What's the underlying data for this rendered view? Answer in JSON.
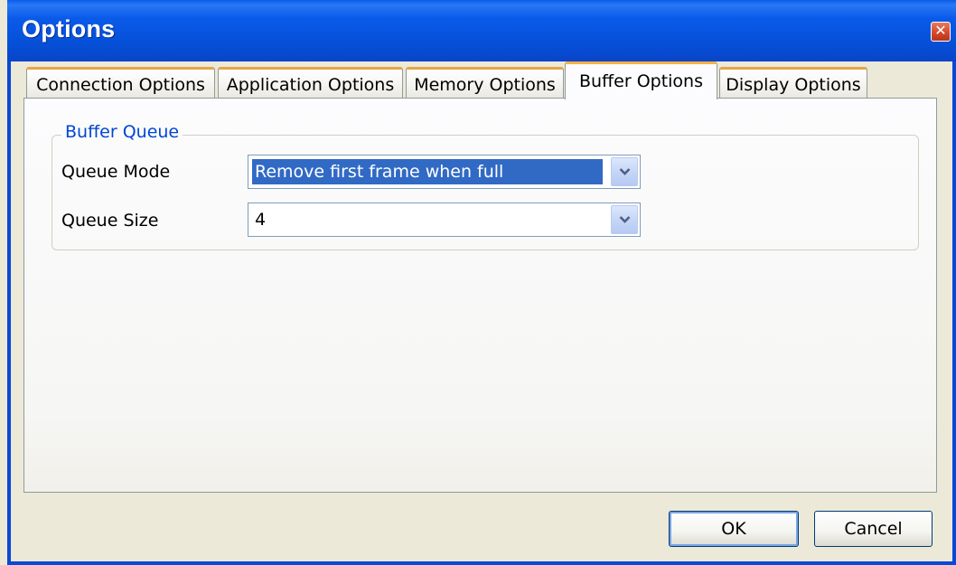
{
  "window": {
    "title": "Options"
  },
  "tabs": [
    {
      "label": "Connection Options",
      "active": false
    },
    {
      "label": "Application Options",
      "active": false
    },
    {
      "label": "Memory Options",
      "active": false
    },
    {
      "label": "Buffer Options",
      "active": true
    },
    {
      "label": "Display Options",
      "active": false
    }
  ],
  "buffer_queue": {
    "legend": "Buffer Queue",
    "queue_mode": {
      "label": "Queue Mode",
      "value": "Remove first frame when full"
    },
    "queue_size": {
      "label": "Queue Size",
      "value": "4"
    }
  },
  "buttons": {
    "ok": "OK",
    "cancel": "Cancel"
  },
  "colors": {
    "titlebar": "#0a5ae9",
    "tab_highlight": "#f6b248",
    "group_legend": "#0046d5",
    "selection": "#316ac5"
  },
  "icons": {
    "close": "close-icon",
    "dropdown": "chevron-down-icon"
  }
}
